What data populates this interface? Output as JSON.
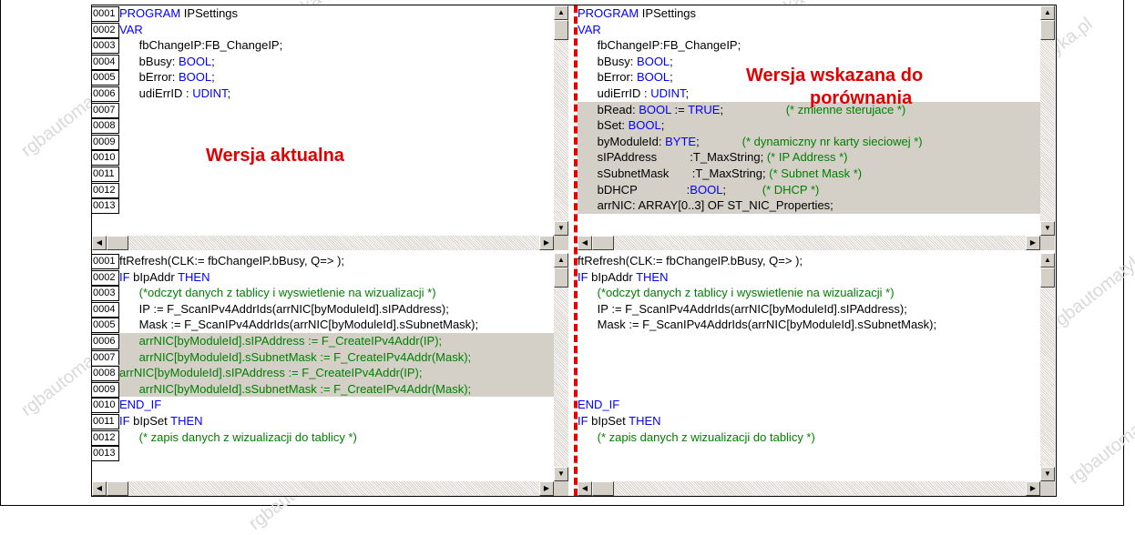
{
  "watermark": "rgbautomatyka.pl",
  "labels": {
    "current": "Wersja aktualna",
    "compare_line1": "Wersja wskazana do",
    "compare_line2": "porównania"
  },
  "top_left": [
    {
      "n": "0001",
      "segs": [
        {
          "c": "kw",
          "t": "PROGRAM"
        },
        {
          "c": "",
          "t": " IPSettings"
        }
      ]
    },
    {
      "n": "0002",
      "segs": [
        {
          "c": "kw",
          "t": "VAR"
        }
      ]
    },
    {
      "n": "0003",
      "segs": [
        {
          "c": "",
          "t": "      fbChangeIP:FB_ChangeIP;"
        }
      ]
    },
    {
      "n": "0004",
      "segs": [
        {
          "c": "",
          "t": "      bBusy: "
        },
        {
          "c": "kw",
          "t": "BOOL"
        },
        {
          "c": "",
          "t": ";"
        }
      ]
    },
    {
      "n": "0005",
      "segs": [
        {
          "c": "",
          "t": "      bError: "
        },
        {
          "c": "kw",
          "t": "BOOL"
        },
        {
          "c": "",
          "t": ";"
        }
      ]
    },
    {
      "n": "0006",
      "segs": [
        {
          "c": "",
          "t": "      udiErrID : "
        },
        {
          "c": "kw",
          "t": "UDINT"
        },
        {
          "c": "",
          "t": ";"
        }
      ]
    },
    {
      "n": "0007",
      "segs": []
    },
    {
      "n": "0008",
      "segs": []
    },
    {
      "n": "0009",
      "segs": []
    },
    {
      "n": "0010",
      "segs": []
    },
    {
      "n": "0011",
      "segs": []
    },
    {
      "n": "0012",
      "segs": []
    },
    {
      "n": "0013",
      "segs": []
    }
  ],
  "top_right": [
    {
      "hl": false,
      "segs": [
        {
          "c": "kw",
          "t": "PROGRAM"
        },
        {
          "c": "",
          "t": " IPSettings"
        }
      ]
    },
    {
      "hl": false,
      "segs": [
        {
          "c": "kw",
          "t": "VAR"
        }
      ]
    },
    {
      "hl": false,
      "segs": [
        {
          "c": "",
          "t": "      fbChangeIP:FB_ChangeIP;"
        }
      ]
    },
    {
      "hl": false,
      "segs": [
        {
          "c": "",
          "t": "      bBusy: "
        },
        {
          "c": "kw",
          "t": "BOOL"
        },
        {
          "c": "",
          "t": ";"
        }
      ]
    },
    {
      "hl": false,
      "segs": [
        {
          "c": "",
          "t": "      bError: "
        },
        {
          "c": "kw",
          "t": "BOOL"
        },
        {
          "c": "",
          "t": ";"
        }
      ]
    },
    {
      "hl": false,
      "segs": [
        {
          "c": "",
          "t": "      udiErrID : "
        },
        {
          "c": "kw",
          "t": "UDINT"
        },
        {
          "c": "",
          "t": ";"
        }
      ]
    },
    {
      "hl": true,
      "segs": [
        {
          "c": "",
          "t": "      bRead: "
        },
        {
          "c": "kw",
          "t": "BOOL"
        },
        {
          "c": "",
          "t": " := "
        },
        {
          "c": "kw",
          "t": "TRUE"
        },
        {
          "c": "",
          "t": ";                   "
        },
        {
          "c": "cm",
          "t": "(* zmienne sterujace *)"
        }
      ]
    },
    {
      "hl": true,
      "segs": [
        {
          "c": "",
          "t": "      bSet: "
        },
        {
          "c": "kw",
          "t": "BOOL"
        },
        {
          "c": "",
          "t": ";"
        }
      ]
    },
    {
      "hl": true,
      "segs": [
        {
          "c": "",
          "t": "      byModuleId: "
        },
        {
          "c": "kw",
          "t": "BYTE"
        },
        {
          "c": "",
          "t": ";             "
        },
        {
          "c": "cm",
          "t": "(* dynamiczny nr karty sieciowej *)"
        }
      ]
    },
    {
      "hl": true,
      "segs": [
        {
          "c": "",
          "t": "      sIPAddress          :T_MaxString; "
        },
        {
          "c": "cm",
          "t": "(* IP Address *)"
        }
      ]
    },
    {
      "hl": true,
      "segs": [
        {
          "c": "",
          "t": "      sSubnetMask       :T_MaxString; "
        },
        {
          "c": "cm",
          "t": "(* Subnet Mask *)"
        }
      ]
    },
    {
      "hl": true,
      "segs": [
        {
          "c": "",
          "t": "      bDHCP               :"
        },
        {
          "c": "kw",
          "t": "BOOL"
        },
        {
          "c": "",
          "t": ";           "
        },
        {
          "c": "cm",
          "t": "(* DHCP *)"
        }
      ]
    },
    {
      "hl": true,
      "segs": [
        {
          "c": "",
          "t": "      arrNIC: ARRAY[0..3] OF ST_NIC_Properties;"
        }
      ]
    }
  ],
  "bottom_left": [
    {
      "n": "0001",
      "hl": false,
      "segs": [
        {
          "c": "",
          "t": "ftRefresh(CLK:= fbChangeIP.bBusy, Q=> );"
        }
      ]
    },
    {
      "n": "0002",
      "hl": false,
      "segs": [
        {
          "c": "kw",
          "t": "IF"
        },
        {
          "c": "",
          "t": " bIpAddr "
        },
        {
          "c": "kw",
          "t": "THEN"
        }
      ]
    },
    {
      "n": "0003",
      "hl": false,
      "segs": [
        {
          "c": "cm",
          "t": "      (*odczyt danych z tablicy i wyswietlenie na wizualizacji *)"
        }
      ]
    },
    {
      "n": "0004",
      "hl": false,
      "segs": [
        {
          "c": "",
          "t": "      IP := F_ScanIPv4AddrIds(arrNIC[byModuleId].sIPAddress);"
        }
      ]
    },
    {
      "n": "0005",
      "hl": false,
      "segs": [
        {
          "c": "",
          "t": "      Mask := F_ScanIPv4AddrIds(arrNIC[byModuleId].sSubnetMask);"
        }
      ]
    },
    {
      "n": "0006",
      "hl": true,
      "segs": [
        {
          "c": "cm",
          "t": "      arrNIC[byModuleId].sIPAddress := F_CreateIPv4Addr(IP);"
        }
      ]
    },
    {
      "n": "0007",
      "hl": true,
      "segs": [
        {
          "c": "cm",
          "t": "      arrNIC[byModuleId].sSubnetMask := F_CreateIPv4Addr(Mask);"
        }
      ]
    },
    {
      "n": "0008",
      "hl": true,
      "segs": [
        {
          "c": "cm",
          "t": "arrNIC[byModuleId].sIPAddress := F_CreateIPv4Addr(IP);"
        }
      ]
    },
    {
      "n": "0009",
      "hl": true,
      "segs": [
        {
          "c": "cm",
          "t": "      arrNIC[byModuleId].sSubnetMask := F_CreateIPv4Addr(Mask);"
        }
      ]
    },
    {
      "n": "0010",
      "hl": false,
      "segs": [
        {
          "c": "kw",
          "t": "END_IF"
        }
      ]
    },
    {
      "n": "0011",
      "hl": false,
      "segs": [
        {
          "c": "kw",
          "t": "IF"
        },
        {
          "c": "",
          "t": " bIpSet "
        },
        {
          "c": "kw",
          "t": "THEN"
        }
      ]
    },
    {
      "n": "0012",
      "hl": false,
      "segs": [
        {
          "c": "cm",
          "t": "      (* zapis danych z wizualizacji do tablicy *)"
        }
      ]
    },
    {
      "n": "0013",
      "hl": false,
      "segs": []
    }
  ],
  "bottom_right": [
    {
      "hl": false,
      "segs": [
        {
          "c": "",
          "t": "ftRefresh(CLK:= fbChangeIP.bBusy, Q=> );"
        }
      ]
    },
    {
      "hl": false,
      "segs": [
        {
          "c": "kw",
          "t": "IF"
        },
        {
          "c": "",
          "t": " bIpAddr "
        },
        {
          "c": "kw",
          "t": "THEN"
        }
      ]
    },
    {
      "hl": false,
      "segs": [
        {
          "c": "cm",
          "t": "      (*odczyt danych z tablicy i wyswietlenie na wizualizacji *)"
        }
      ]
    },
    {
      "hl": false,
      "segs": [
        {
          "c": "",
          "t": "      IP := F_ScanIPv4AddrIds(arrNIC[byModuleId].sIPAddress);"
        }
      ]
    },
    {
      "hl": false,
      "segs": [
        {
          "c": "",
          "t": "      Mask := F_ScanIPv4AddrIds(arrNIC[byModuleId].sSubnetMask);"
        }
      ]
    },
    {
      "hl": false,
      "segs": []
    },
    {
      "hl": false,
      "segs": []
    },
    {
      "hl": false,
      "segs": []
    },
    {
      "hl": false,
      "segs": []
    },
    {
      "hl": false,
      "segs": [
        {
          "c": "kw",
          "t": "END_IF"
        }
      ]
    },
    {
      "hl": false,
      "segs": [
        {
          "c": "kw",
          "t": "IF"
        },
        {
          "c": "",
          "t": " bIpSet "
        },
        {
          "c": "kw",
          "t": "THEN"
        }
      ]
    },
    {
      "hl": false,
      "segs": [
        {
          "c": "cm",
          "t": "      (* zapis danych z wizualizacji do tablicy *)"
        }
      ]
    },
    {
      "hl": false,
      "segs": []
    }
  ]
}
